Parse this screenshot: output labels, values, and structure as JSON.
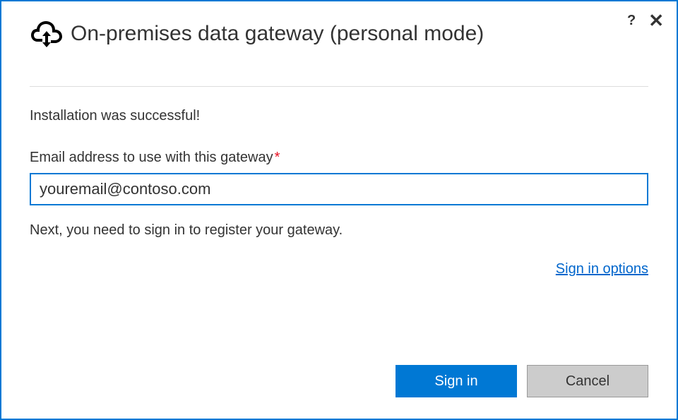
{
  "header": {
    "title": "On-premises data gateway (personal mode)",
    "help_label": "?",
    "close_label": "✕"
  },
  "content": {
    "status": "Installation was successful!",
    "email_label": "Email address to use with this gateway",
    "required_mark": "*",
    "email_value": "youremail@contoso.com",
    "hint": "Next, you need to sign in to register your gateway.",
    "options_link": "Sign in options"
  },
  "footer": {
    "primary": "Sign in",
    "secondary": "Cancel"
  }
}
